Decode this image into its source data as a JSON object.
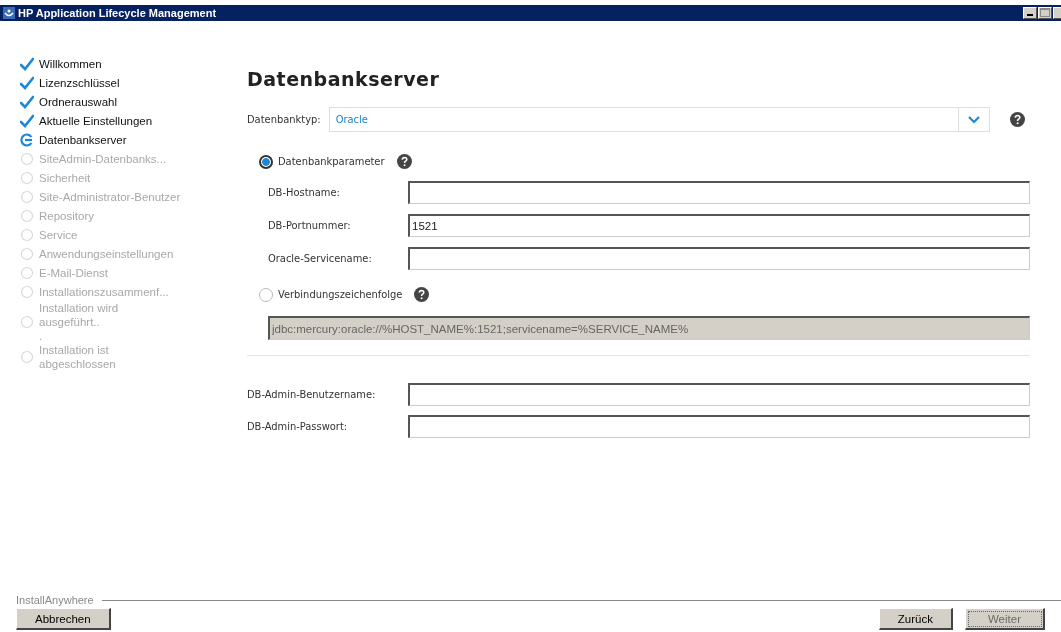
{
  "window": {
    "title": "HP Application Lifecycle Management"
  },
  "steps": [
    {
      "label": "Willkommen",
      "kind": "done"
    },
    {
      "label": "Lizenzschlüssel",
      "kind": "done"
    },
    {
      "label": "Ordnerauswahl",
      "kind": "done"
    },
    {
      "label": "Aktuelle Einstellungen",
      "kind": "done"
    },
    {
      "label": "Datenbankserver",
      "kind": "current"
    },
    {
      "label": "SiteAdmin-Datenbanks...",
      "kind": "pending"
    },
    {
      "label": "Sicherheit",
      "kind": "pending"
    },
    {
      "label": "Site-Administrator-Benutzer",
      "kind": "pending"
    },
    {
      "label": "Repository",
      "kind": "pending"
    },
    {
      "label": "Service",
      "kind": "pending"
    },
    {
      "label": "Anwendungseinstellungen",
      "kind": "pending"
    },
    {
      "label": "E-Mail-Dienst",
      "kind": "pending"
    },
    {
      "label": "Installationszusammenf...",
      "kind": "pending"
    },
    {
      "label": "Installation wird\nausgeführt..\n.",
      "kind": "pending"
    },
    {
      "label": "Installation ist\nabgeschlossen",
      "kind": "pending"
    }
  ],
  "page_title": "Datenbankserver",
  "database_type": {
    "label": "Datenbanktyp:",
    "value": "Oracle"
  },
  "parameters": {
    "label": "Datenbankparameter",
    "selected": true,
    "fields": [
      {
        "label": "DB-Hostname:"
      },
      {
        "label": "DB-Portnummer:",
        "value": "1521"
      },
      {
        "label": "Oracle-Servicename:"
      }
    ]
  },
  "connection_string": {
    "label": "Verbindungszeichenfolge",
    "selected": false,
    "value": "jdbc:mercury:oracle://%HOST_NAME%:1521;servicename=%SERVICE_NAME%",
    "disabled": true
  },
  "admin_fields": [
    {
      "label": "DB-Admin-Benutzername:"
    },
    {
      "label": "DB-Admin-Passwort:"
    }
  ],
  "footer": {
    "brand": "InstallAnywhere",
    "buttons": [
      {
        "label": "Abbrechen",
        "disabled": false
      },
      {
        "label": "Zurück",
        "disabled": false
      },
      {
        "label": "Weiter",
        "disabled": true
      }
    ]
  }
}
